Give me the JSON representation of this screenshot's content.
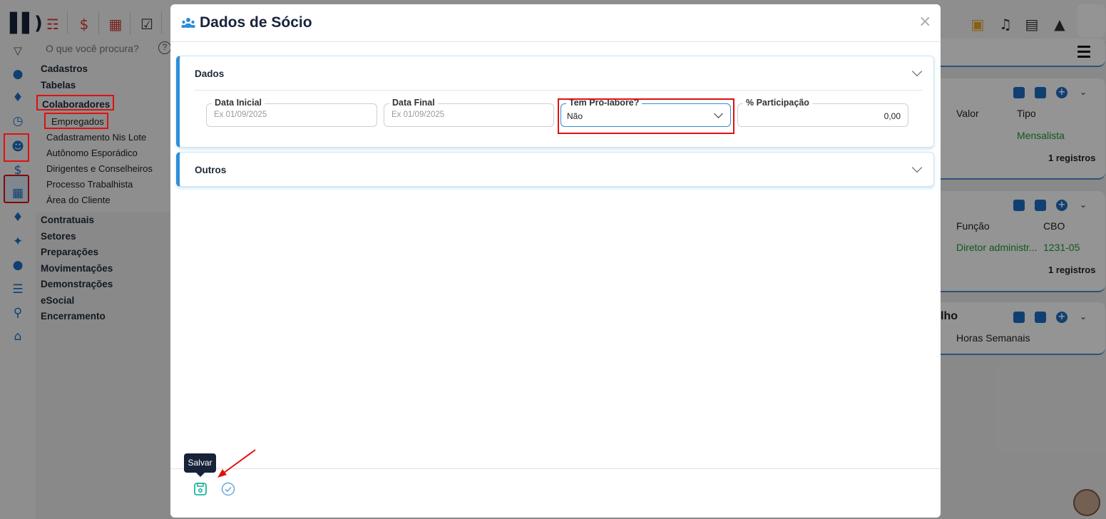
{
  "search": {
    "placeholder": "O que você procura?",
    "help": "?"
  },
  "menu": {
    "items": [
      "Cadastros",
      "Tabelas",
      "Colaboradores"
    ],
    "sub_items": [
      "Empregados",
      "Cadastramento Nis Lote",
      "Autônomo Esporádico",
      "Dirigentes e Conselheiros",
      "Processo Trabalhista",
      "Área do Cliente"
    ],
    "items_after": [
      "Contratuais",
      "Setores",
      "Preparações",
      "Movimentações",
      "Demonstrações",
      "eSocial",
      "Encerramento"
    ]
  },
  "background": {
    "card1": {
      "col_valor": "Valor",
      "col_tipo": "Tipo",
      "tipo_value": "Mensalista",
      "count": "1 registros"
    },
    "card2": {
      "col_funcao": "Função",
      "col_cbo": "CBO",
      "funcao_value": "Diretor administr...",
      "cbo_value": "1231-05",
      "count": "1 registros"
    },
    "card3": {
      "title_tail": "lho",
      "col_horas": "Horas Semanais"
    }
  },
  "modal": {
    "title": "Dados de Sócio",
    "close": "×",
    "sections": {
      "dados": {
        "title": "Dados",
        "fields": {
          "data_inicial": {
            "label": "Data Inicial",
            "placeholder": "Ex 01/09/2025",
            "value": ""
          },
          "data_final": {
            "label": "Data Final",
            "placeholder": "Ex 01/09/2025",
            "value": ""
          },
          "tem_pro_labore": {
            "label": "Tem Pró-labore?",
            "value": "Não"
          },
          "participacao": {
            "label": "% Participação",
            "value": "0,00"
          }
        }
      },
      "outros": {
        "title": "Outros"
      }
    },
    "footer": {
      "tooltip": "Salvar"
    }
  },
  "colors": {
    "accent": "#2d8fd8",
    "save_green": "#1fb7a0",
    "highlight_red": "#e01010",
    "title_dark": "#17233a"
  }
}
